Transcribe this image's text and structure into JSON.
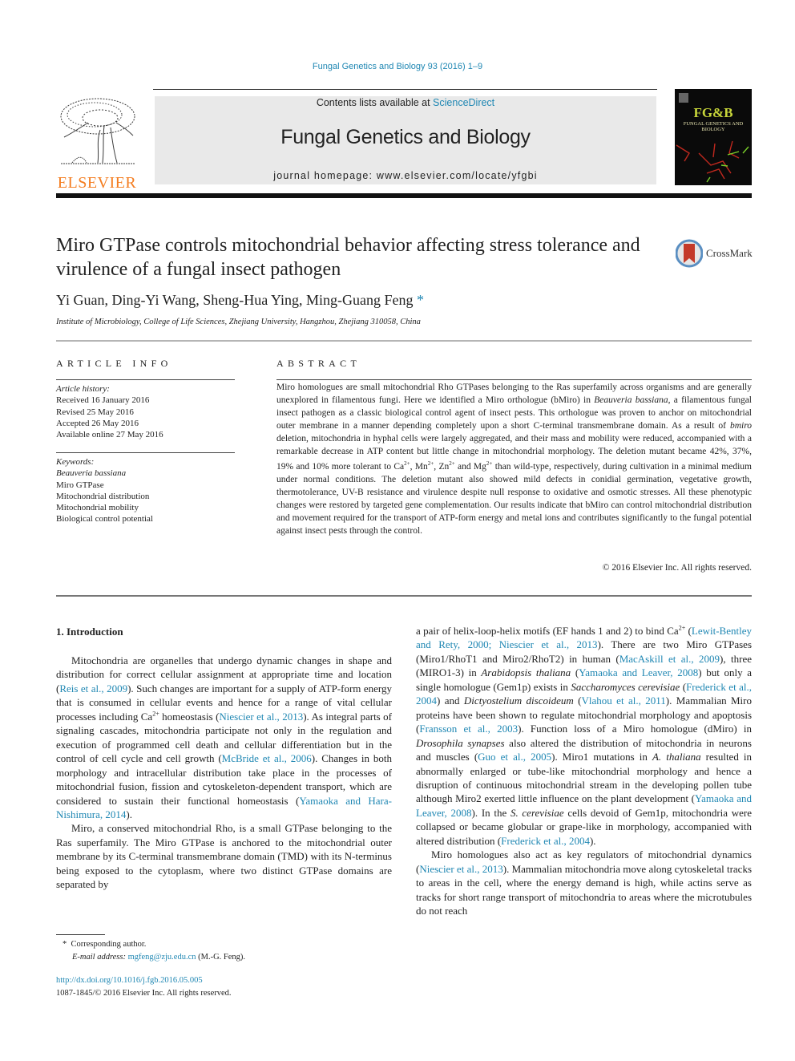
{
  "header": {
    "journal_ref": "Fungal Genetics and Biology 93 (2016) 1–9",
    "contents_prefix": "Contents lists available at ",
    "contents_link": "ScienceDirect",
    "journal_title": "Fungal Genetics and Biology",
    "homepage_prefix": "journal homepage: ",
    "homepage_url": "www.elsevier.com/locate/yfgbi",
    "publisher_logo": "ELSEVIER",
    "cover_title": "FG&B",
    "cover_subtitle": "FUNGAL GENETICS AND BIOLOGY",
    "brand_color": "#f47d20",
    "link_color": "#1f87b3"
  },
  "article": {
    "title": "Miro GTPase controls mitochondrial behavior affecting stress tolerance and virulence of a fungal insect pathogen",
    "crossmark_label": "CrossMark",
    "authors": "Yi Guan, Ding-Yi Wang, Sheng-Hua Ying, Ming-Guang Feng",
    "corresponding_marker": "*",
    "affiliation": "Institute of Microbiology, College of Life Sciences, Zhejiang University, Hangzhou, Zhejiang 310058, China"
  },
  "article_info": {
    "heading": "ARTICLE INFO",
    "history_label": "Article history:",
    "history": [
      "Received 16 January 2016",
      "Revised 25 May 2016",
      "Accepted 26 May 2016",
      "Available online 27 May 2016"
    ],
    "keywords_label": "Keywords:",
    "keywords": [
      "Beauveria bassiana",
      "Miro GTPase",
      "Mitochondrial distribution",
      "Mitochondrial mobility",
      "Biological control potential"
    ]
  },
  "abstract": {
    "heading": "ABSTRACT",
    "p1": "Miro homologues are small mitochondrial Rho GTPases belonging to the Ras superfamily across organisms and are generally unexplored in filamentous fungi. Here we identified a Miro orthologue (bMiro) in ",
    "species": "Beauveria bassiana",
    "p2": ", a filamentous fungal insect pathogen as a classic biological control agent of insect pests. This orthologue was proven to anchor on mitochondrial outer membrane in a manner depending completely upon a short C-terminal transmembrane domain. As a result of ",
    "gene": "bmiro",
    "p3": " deletion, mitochondria in hyphal cells were largely aggregated, and their mass and mobility were reduced, accompanied with a remarkable decrease in ATP content but little change in mitochondrial morphology. The deletion mutant became 42%, 37%, 19% and 10% more tolerant to Ca",
    "ion_sup": "2+",
    "ion2": ", Mn",
    "ion3": ", Zn",
    "ion4": " and Mg",
    "p4": " than wild-type, respectively, during cultivation in a minimal medium under normal conditions. The deletion mutant also showed mild defects in conidial germination, vegetative growth, thermotolerance, UV-B resistance and virulence despite null response to oxidative and osmotic stresses. All these phenotypic changes were restored by targeted gene complementation. Our results indicate that bMiro can control mitochondrial distribution and movement required for the transport of ATP-form energy and metal ions and contributes significantly to the fungal potential against insect pests through the control.",
    "copyright": "© 2016 Elsevier Inc. All rights reserved."
  },
  "introduction": {
    "heading": "1. Introduction",
    "left": {
      "a1": "Mitochondria are organelles that undergo dynamic changes in shape and distribution for correct cellular assignment at appropriate time and location (",
      "c1": "Reis et al., 2009",
      "a2": "). Such changes are important for a supply of ATP-form energy that is consumed in cellular events and hence for a range of vital cellular processes including Ca",
      "sup": "2+",
      "a3": " homeostasis (",
      "c2": "Niescier et al., 2013",
      "a4": "). As integral parts of signaling cascades, mitochondria participate not only in the regulation and execution of programmed cell death and cellular differentiation but in the control of cell cycle and cell growth (",
      "c3": "McBride et al., 2006",
      "a5": "). Changes in both morphology and intracellular distribution take place in the processes of mitochondrial fusion, fission and cytoskeleton-dependent transport, which are considered to sustain their functional homeostasis (",
      "c4": "Yamaoka and Hara-Nishimura, 2014",
      "a6": ").",
      "b1": "Miro, a conserved mitochondrial Rho, is a small GTPase belonging to the Ras superfamily. The Miro GTPase is anchored to the mitochondrial outer membrane by its C-terminal transmembrane domain (TMD) with its N-terminus being exposed to the cytoplasm, where two distinct GTPase domains are separated by"
    },
    "right": {
      "a1": "a pair of helix-loop-helix motifs (EF hands 1 and 2) to bind Ca",
      "sup": "2+",
      "a2": " (",
      "c1": "Lewit-Bentley and Rety, 2000; Niescier et al., 2013",
      "a3": "). There are two Miro GTPases (Miro1/RhoT1 and Miro2/RhoT2) in human (",
      "c2": "MacAskill et al., 2009",
      "a4": "), three (MIRO1-3) in ",
      "i1": "Arabidopsis thaliana",
      "a5": " (",
      "c3": "Yamaoka and Leaver, 2008",
      "a6": ") but only a single homologue (Gem1p) exists in ",
      "i2": "Saccharomyces cerevisiae",
      "a7": " (",
      "c4": "Frederick et al., 2004",
      "a8": ") and ",
      "i3": "Dictyostelium discoideum",
      "a9": " (",
      "c5": "Vlahou et al., 2011",
      "a10": "). Mammalian Miro proteins have been shown to regulate mitochondrial morphology and apoptosis (",
      "c6": "Fransson et al., 2003",
      "a11": "). Function loss of a Miro homologue (dMiro) in ",
      "i4": "Drosophila synapses",
      "a12": " also altered the distribution of mitochondria in neurons and muscles (",
      "c7": "Guo et al., 2005",
      "a13": "). Miro1 mutations in ",
      "i5": "A. thaliana",
      "a14": " resulted in abnormally enlarged or tube-like mitochondrial morphology and hence a disruption of continuous mitochondrial stream in the developing pollen tube although Miro2 exerted little influence on the plant development (",
      "c8": "Yamaoka and Leaver, 2008",
      "a15": "). In the ",
      "i6": "S. cerevisiae",
      "a16": " cells devoid of Gem1p, mitochondria were collapsed or became globular or grape-like in morphology, accompanied with altered distribution (",
      "c9": "Frederick et al., 2004",
      "a17": ").",
      "b1": "Miro homologues also act as key regulators of mitochondrial dynamics (",
      "c10": "Niescier et al., 2013",
      "b2": "). Mammalian mitochondria move along cytoskeletal tracks to areas in the cell, where the energy demand is high, while actins serve as tracks for short range transport of mitochondria to areas where the microtubules do not reach"
    }
  },
  "footnote": {
    "marker": "*",
    "corresponding": "Corresponding author.",
    "email_label": "E-mail address:",
    "email": "mgfeng@zju.edu.cn",
    "email_suffix": " (M.-G. Feng).",
    "doi": "http://dx.doi.org/10.1016/j.fgb.2016.05.005",
    "issn_line": "1087-1845/© 2016 Elsevier Inc. All rights reserved."
  }
}
